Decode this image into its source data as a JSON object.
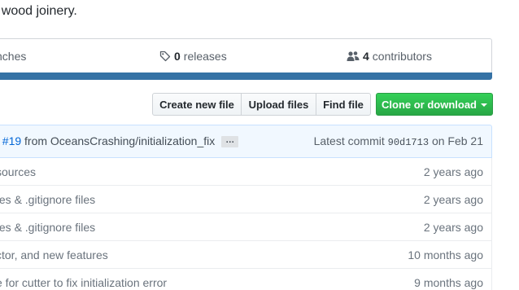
{
  "repo": {
    "description": "r wood joinery."
  },
  "summary": {
    "branches_text": "nches",
    "releases_count": "0",
    "releases_label": "releases",
    "contributors_count": "4",
    "contributors_label": "contributors",
    "language_color": "#3572a5"
  },
  "file_nav": {
    "create_new_file": "Create new file",
    "upload_files": "Upload files",
    "find_file": "Find file",
    "clone_or_download": "Clone or download"
  },
  "commit_tease": {
    "message_prefix": "t ",
    "pr_link": "#19",
    "message_rest": " from OceansCrashing/initialization_fix",
    "ellipsis": "…",
    "latest_commit_label": "Latest commit",
    "sha": "90d1713",
    "date": "on Feb 21"
  },
  "files": [
    {
      "message": "sources",
      "age": "2 years ago"
    },
    {
      "message": "tes & .gitignore files",
      "age": "2 years ago"
    },
    {
      "message": "tes & .gitignore files",
      "age": "2 years ago"
    },
    {
      "message": "ctor, and new features",
      "age": "10 months ago"
    },
    {
      "message": "e for cutter to fix initialization error",
      "age": "9 months ago"
    }
  ],
  "icons": {
    "releases": "tag-icon",
    "contributors": "people-icon"
  }
}
